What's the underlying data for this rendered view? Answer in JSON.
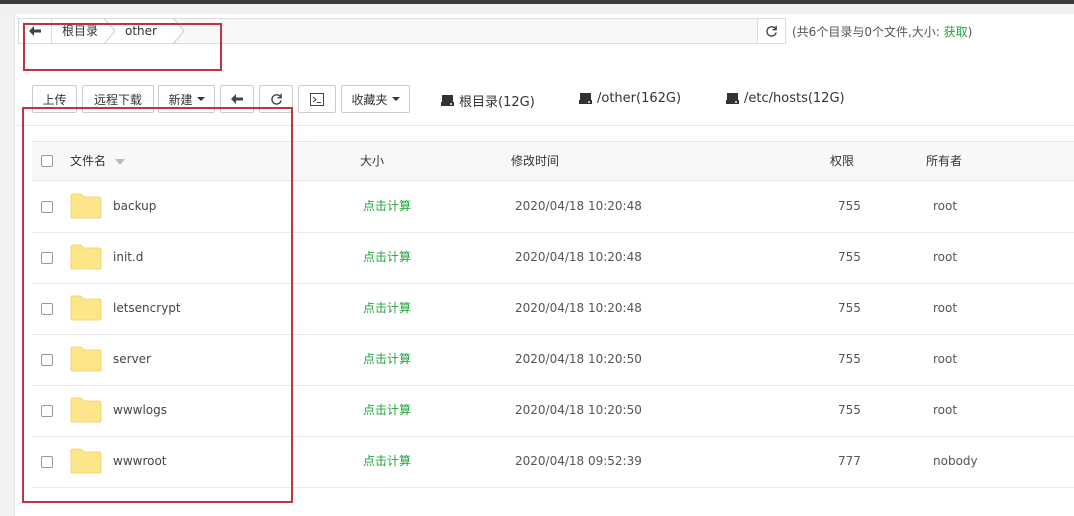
{
  "breadcrumb": {
    "items": [
      "根目录",
      "other"
    ]
  },
  "summary": {
    "prefix": "(共6个目录与0个文件,大小: ",
    "link": "获取",
    "suffix": ")"
  },
  "toolbar": {
    "upload": "上传",
    "remote_download": "远程下载",
    "new": "新建",
    "favorites": "收藏夹"
  },
  "disks": [
    {
      "label": "根目录(12G)"
    },
    {
      "label": "/other(162G)"
    },
    {
      "label": "/etc/hosts(12G)"
    }
  ],
  "table": {
    "headers": {
      "name": "文件名",
      "size": "大小",
      "mtime": "修改时间",
      "perm": "权限",
      "owner": "所有者"
    },
    "rows": [
      {
        "name": "backup",
        "size": "点击计算",
        "mtime": "2020/04/18 10:20:48",
        "perm": "755",
        "owner": "root"
      },
      {
        "name": "init.d",
        "size": "点击计算",
        "mtime": "2020/04/18 10:20:48",
        "perm": "755",
        "owner": "root"
      },
      {
        "name": "letsencrypt",
        "size": "点击计算",
        "mtime": "2020/04/18 10:20:48",
        "perm": "755",
        "owner": "root"
      },
      {
        "name": "server",
        "size": "点击计算",
        "mtime": "2020/04/18 10:20:50",
        "perm": "755",
        "owner": "root"
      },
      {
        "name": "wwwlogs",
        "size": "点击计算",
        "mtime": "2020/04/18 10:20:50",
        "perm": "755",
        "owner": "root"
      },
      {
        "name": "wwwroot",
        "size": "点击计算",
        "mtime": "2020/04/18 09:52:39",
        "perm": "777",
        "owner": "nobody"
      }
    ]
  },
  "colors": {
    "accent": "#20a53a",
    "highlight": "#c9303f",
    "folder": "#fde58a"
  },
  "icons": [
    "arrow-left-icon",
    "refresh-icon",
    "terminal-icon",
    "hdd-icon",
    "folder-icon",
    "sort-caret-icon"
  ]
}
